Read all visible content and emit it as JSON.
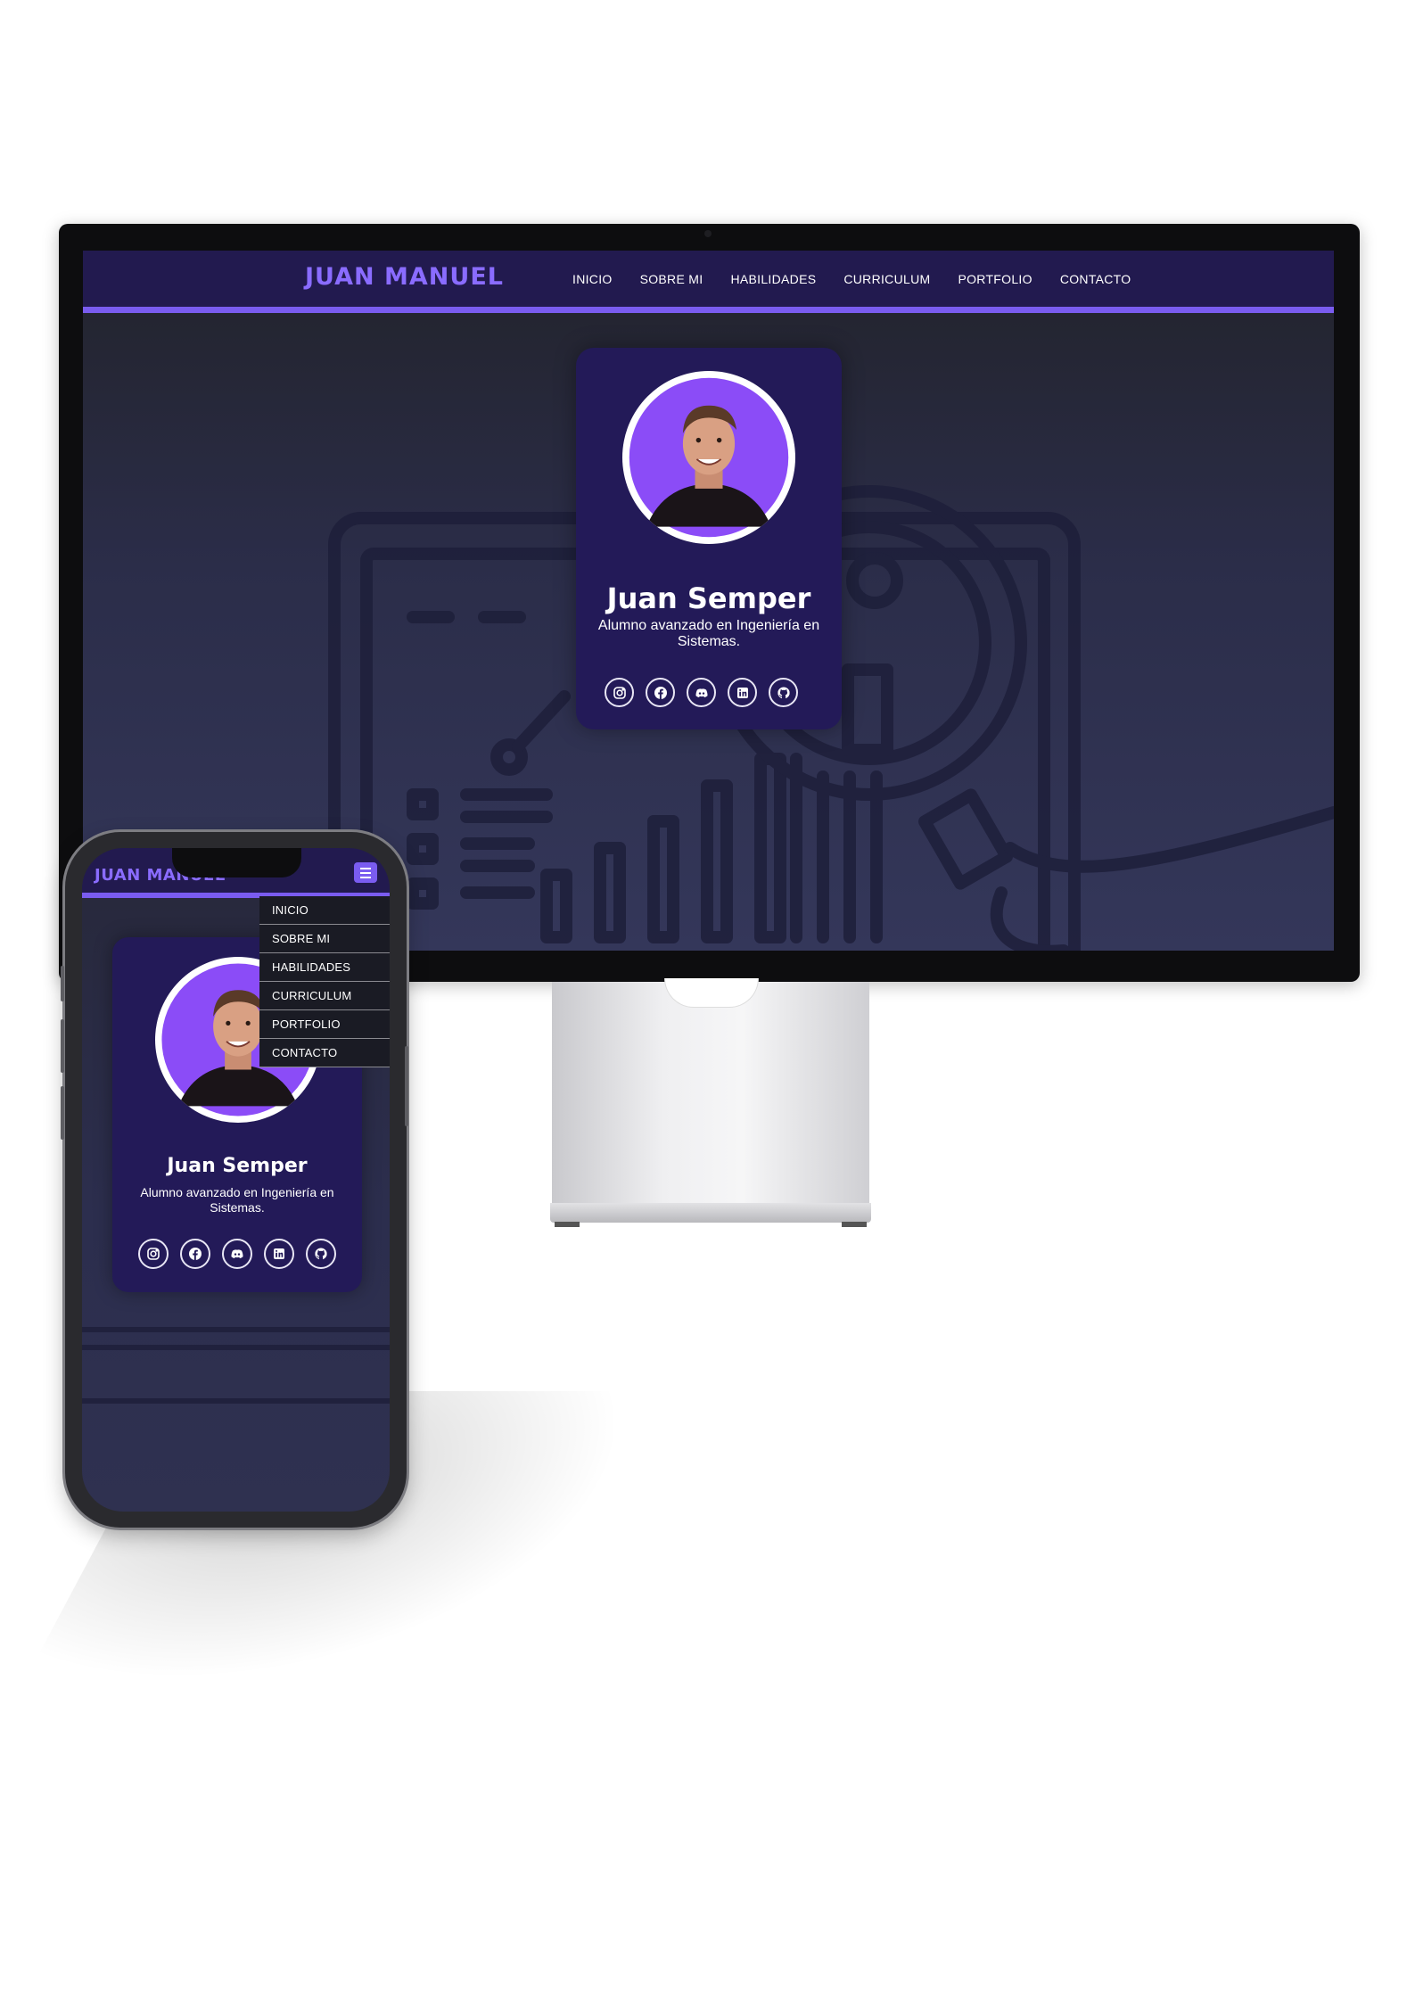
{
  "desktop": {
    "logo": "JUAN MANUEL",
    "nav": [
      "INICIO",
      "SOBRE MI",
      "HABILIDADES",
      "CURRICULUM",
      "PORTFOLIO",
      "CONTACTO"
    ],
    "profile": {
      "name": "Juan Semper",
      "subtitle": "Alumno avanzado en Ingeniería en Sistemas."
    },
    "social_icons": [
      "instagram-icon",
      "facebook-icon",
      "discord-icon",
      "linkedin-icon",
      "github-icon"
    ]
  },
  "mobile": {
    "logo": "JUAN MANUEL",
    "menu_icon": "hamburger-icon",
    "dropdown": [
      "INICIO",
      "SOBRE MI",
      "HABILIDADES",
      "CURRICULUM",
      "PORTFOLIO",
      "CONTACTO"
    ],
    "profile": {
      "name": "Juan Semper",
      "subtitle": "Alumno avanzado en Ingeniería en Sistemas."
    },
    "social_icons": [
      "instagram-icon",
      "facebook-icon",
      "discord-icon",
      "linkedin-icon",
      "github-icon"
    ]
  },
  "colors": {
    "accent": "#7a5cf0",
    "nav_bg": "#221a4f",
    "card_bg": "#231a58",
    "avatar_bg": "#8b4cf7"
  }
}
